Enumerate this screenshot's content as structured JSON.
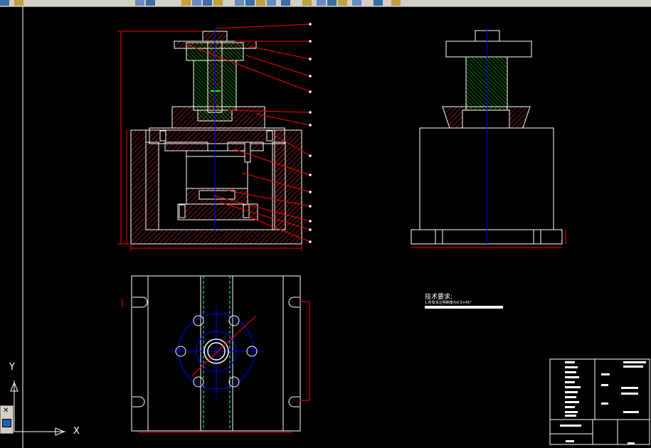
{
  "toolbar": {
    "buttons": [
      "layer-icon",
      "match-icon",
      "new-icon",
      "open-icon",
      "save-icon",
      "print-icon",
      "preview-icon",
      "cut-icon",
      "copy-icon",
      "paste-icon",
      "undo-icon",
      "redo-icon",
      "pan-icon",
      "zoom-icon",
      "properties-icon",
      "design-center-icon",
      "tool-palette-icon",
      "markup-icon",
      "calc-icon",
      "help-icon"
    ]
  },
  "axis": {
    "y_label": "Y",
    "x_label": "X"
  },
  "tech_requirements": {
    "title": "技术要求:",
    "note": "1.所有未注明倒角为0.5×45°"
  },
  "palette": {
    "close_glyph": "✕"
  },
  "colors": {
    "background": "#000000",
    "outline": "#ffffff",
    "dimension": "#ff0000",
    "section": "#00ff00",
    "centerline": "#0000ff",
    "hidden": "#00ffff"
  }
}
